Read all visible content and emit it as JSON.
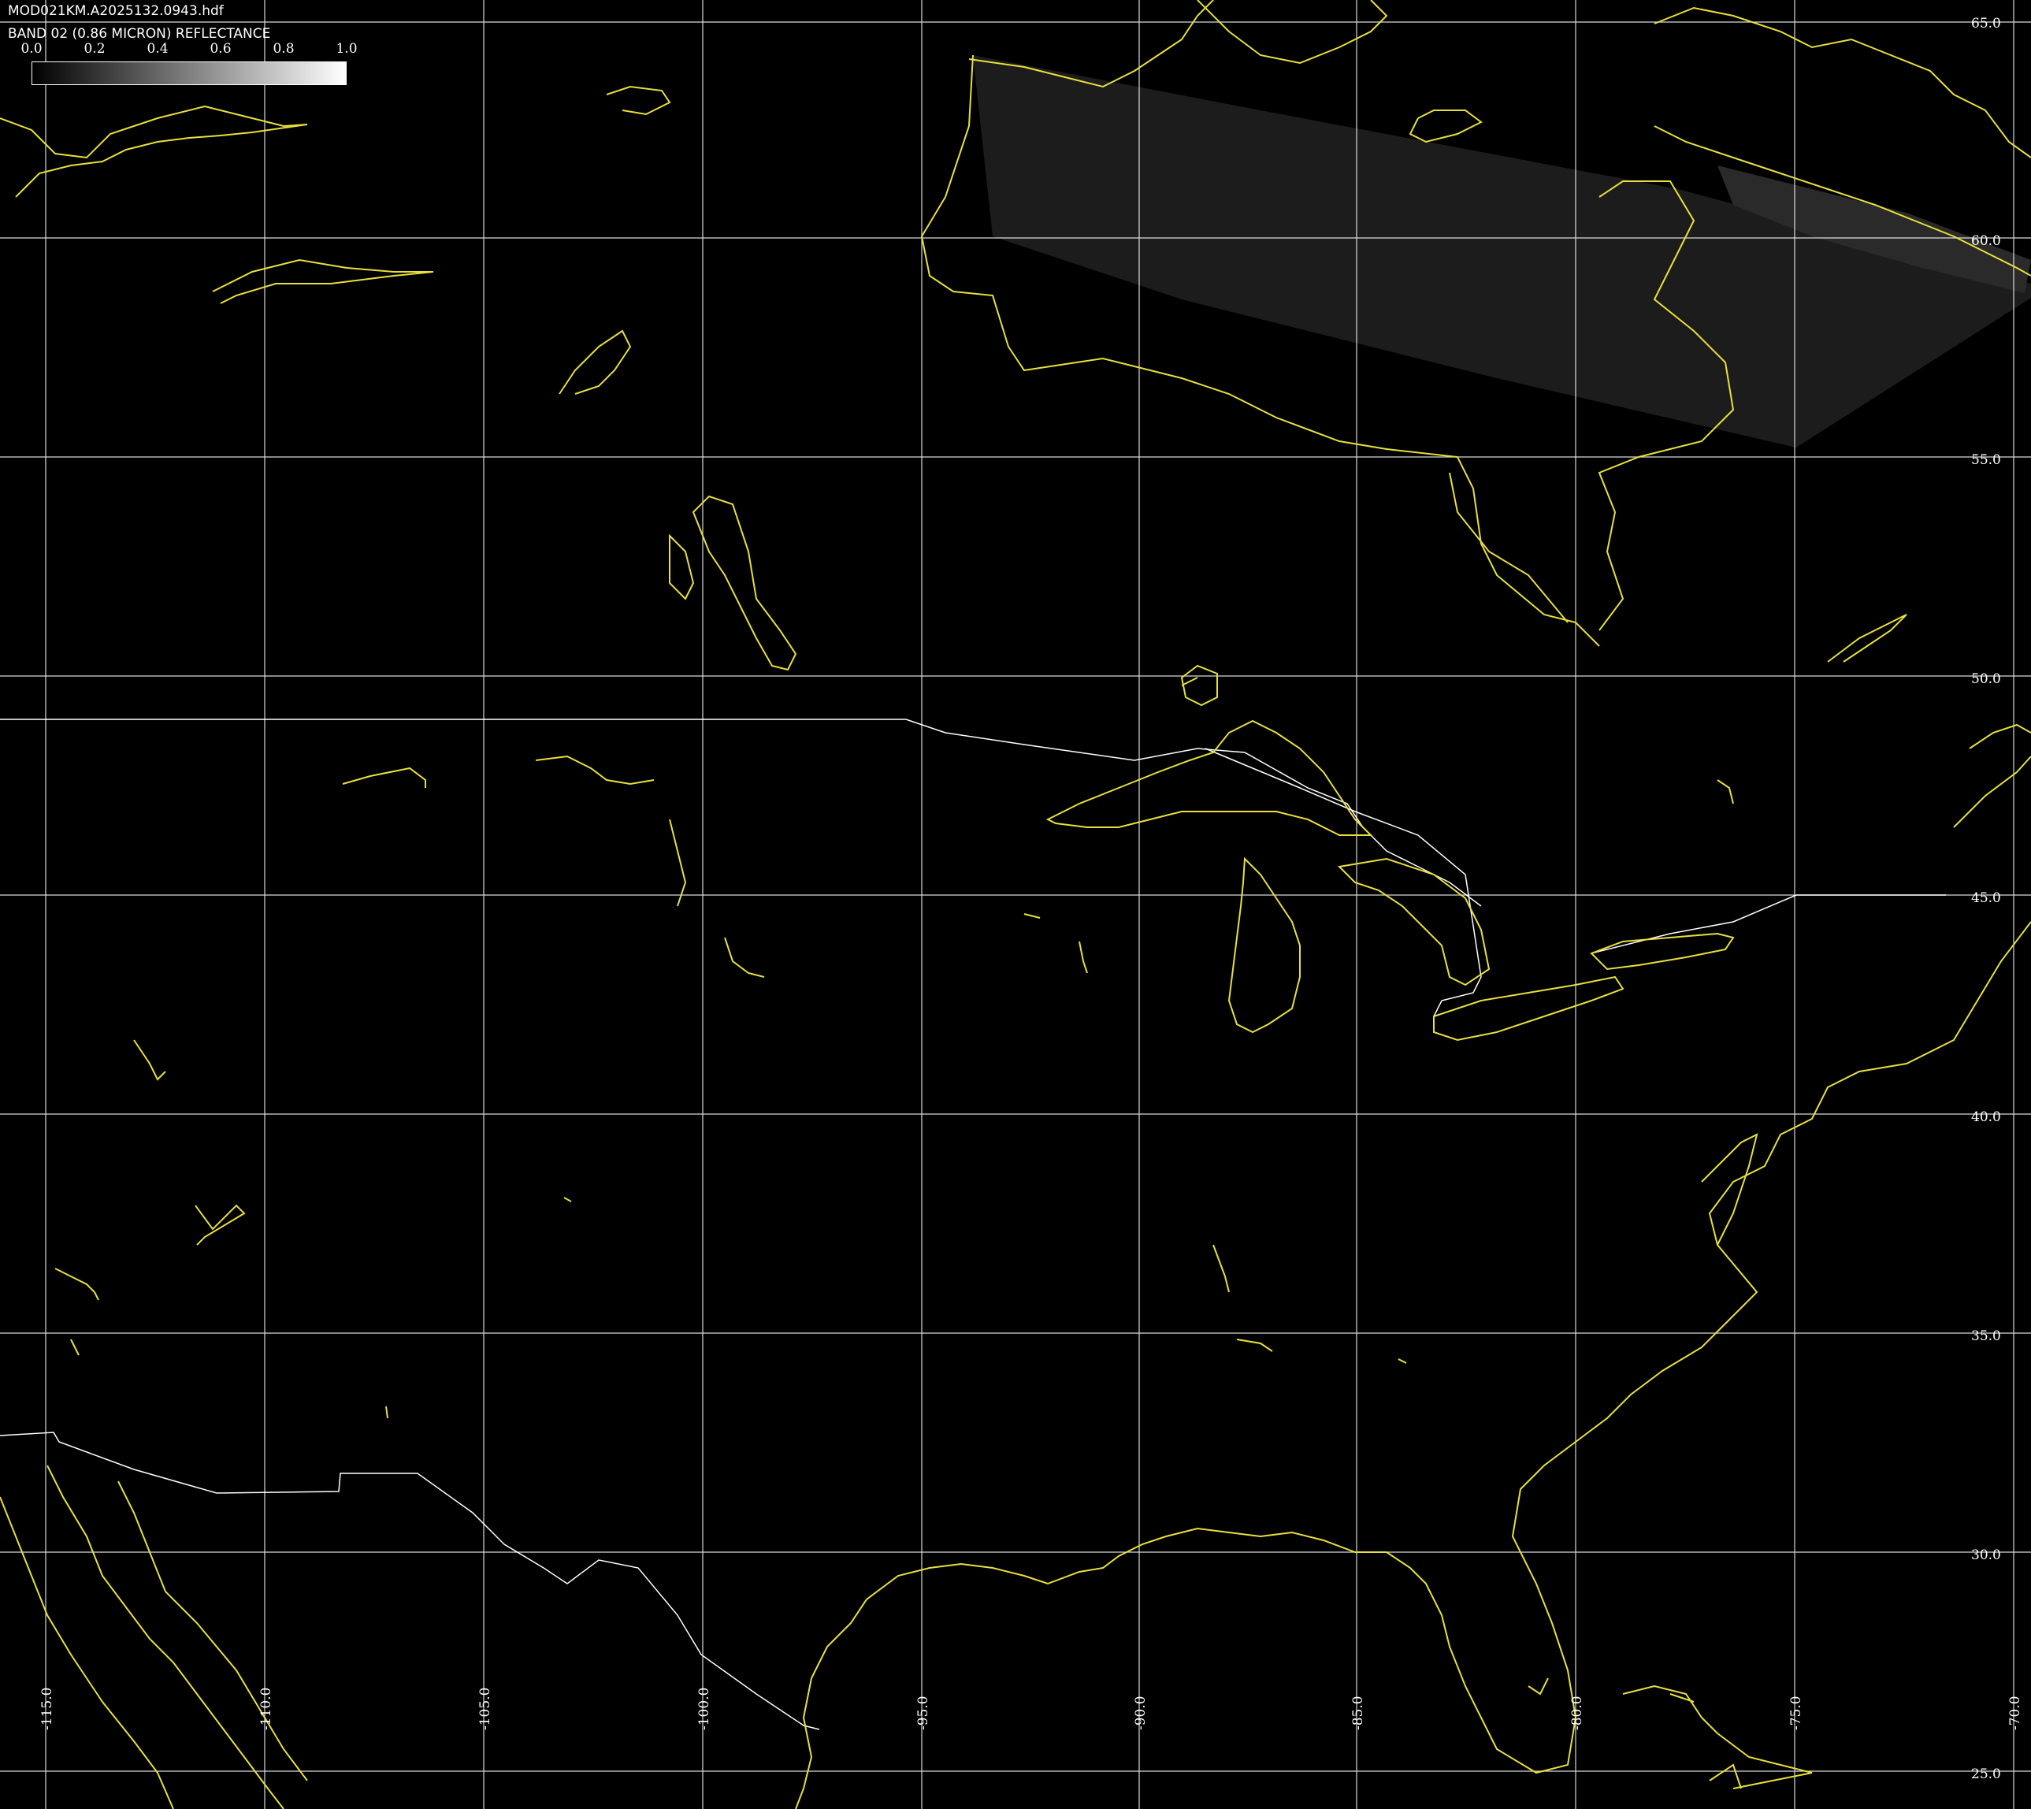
{
  "header": {
    "file": "MOD021KM.A2025132.0943.hdf",
    "band": "BAND 02 (0.86 MICRON) REFLECTANCE"
  },
  "colorbar": {
    "ticks": [
      "0.0",
      "0.2",
      "0.4",
      "0.6",
      "0.8",
      "1.0"
    ],
    "range": [
      0.0,
      1.0
    ],
    "colors": [
      "#000000",
      "#ffffff"
    ]
  },
  "grid": {
    "lat_labels": [
      "65.0",
      "60.0",
      "55.0",
      "50.0",
      "45.0",
      "40.0",
      "35.0",
      "30.0",
      "25.0"
    ],
    "lon_labels": [
      "-115.0",
      "-110.0",
      "-105.0",
      "-100.0",
      "-95.0",
      "-90.0",
      "-85.0",
      "-80.0",
      "-75.0",
      "-70.0"
    ],
    "color": "#ffffff"
  },
  "style": {
    "coast_color": "#e8e03c",
    "border_color": "#ffffff",
    "background": "#000000",
    "swath_fill": "#1c1c1c"
  }
}
